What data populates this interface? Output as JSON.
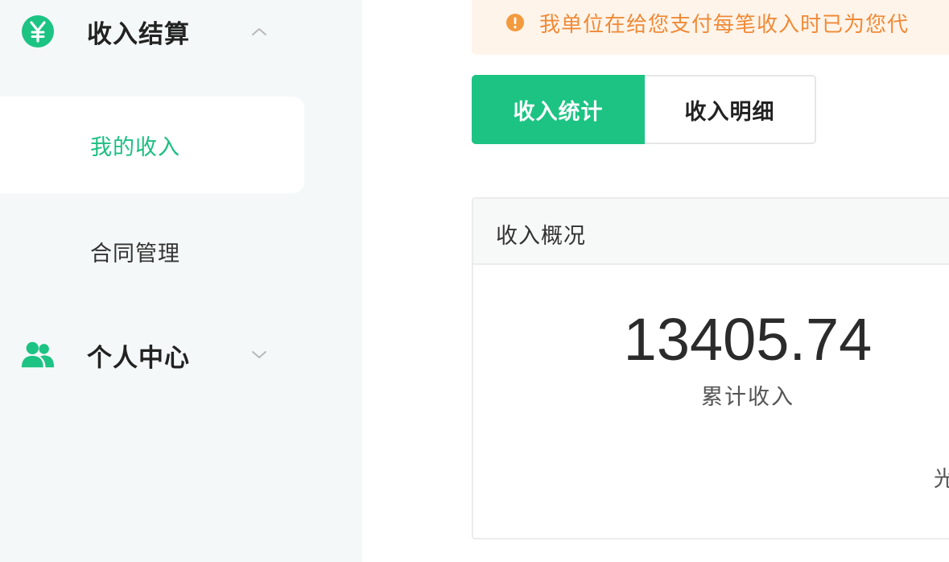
{
  "sidebar": {
    "income_group": {
      "label": "收入结算",
      "icon": "yen-icon",
      "expanded": true,
      "items": [
        {
          "label": "我的收入",
          "active": true
        },
        {
          "label": "合同管理",
          "active": false
        }
      ]
    },
    "personal_group": {
      "label": "个人中心",
      "icon": "users-icon",
      "expanded": false
    }
  },
  "main": {
    "notice": {
      "icon": "info-icon",
      "text": "我单位在给您支付每笔收入时已为您代"
    },
    "tabs": [
      {
        "label": "收入统计",
        "active": true
      },
      {
        "label": "收入明细",
        "active": false
      }
    ],
    "summary_card": {
      "title": "收入概况",
      "total_value": "13405.74",
      "total_label": "累计收入",
      "edge_text": "光"
    }
  },
  "colors": {
    "accent_green": "#1cc383",
    "notice_orange": "#f08a37",
    "notice_bg": "#fff4ea",
    "sidebar_bg": "#f4f8f9"
  }
}
